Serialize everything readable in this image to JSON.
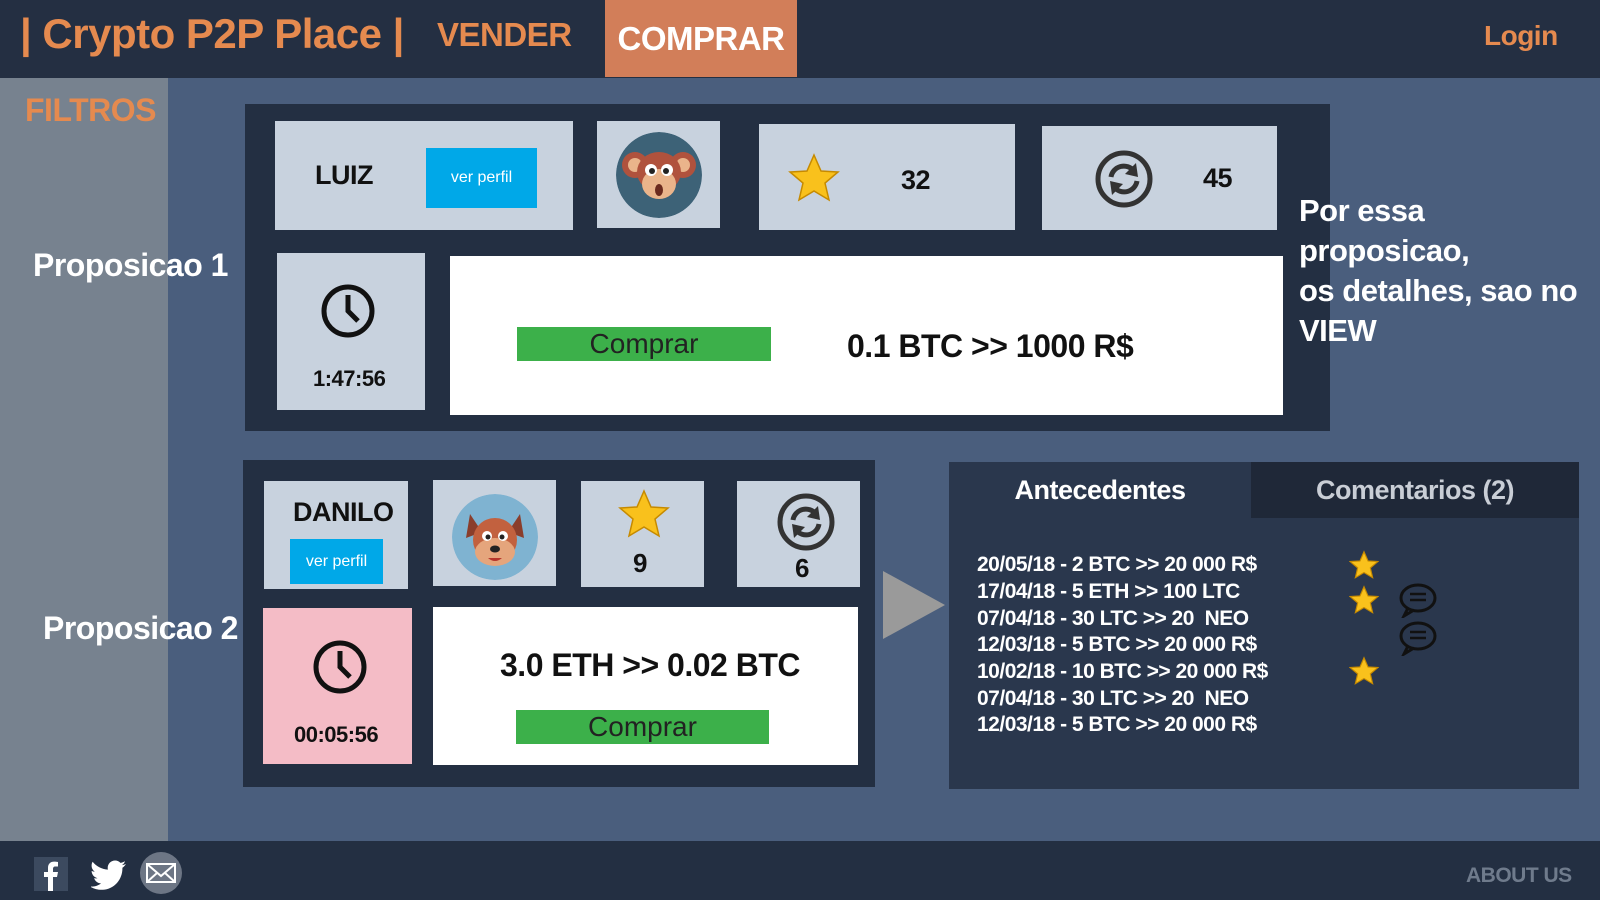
{
  "header": {
    "title": "| Crypto P2P Place |",
    "nav_sell": "VENDER",
    "nav_buy": "COMPRAR",
    "login": "Login",
    "accent": "#e58a4f",
    "active_tab_bg": "#d27e59"
  },
  "sidebar": {
    "filters": "FILTROS",
    "proposal1_label": "Proposicao 1",
    "proposal2_label": "Proposicao 2"
  },
  "proposal1": {
    "user": "LUIZ",
    "profile_button": "ver perfil",
    "avatar_icon": "monkey-avatar-icon",
    "rating": "32",
    "trades": "45",
    "timer": "1:47:56",
    "buy_button": "Comprar",
    "offer": "0.1 BTC >> 1000 R$",
    "note": "Por essa proposicao,\nos detalhes, sao no\nVIEW"
  },
  "proposal2": {
    "user": "DANILO",
    "profile_button": "ver perfil",
    "avatar_icon": "dog-avatar-icon",
    "rating": "9",
    "trades": "6",
    "timer": "00:05:56",
    "offer": "3.0 ETH >> 0.02 BTC",
    "buy_button": "Comprar"
  },
  "history": {
    "tab_history": "Antecedentes",
    "tab_comments": "Comentarios (2)",
    "rows": [
      "20/05/18 - 2 BTC >> 20 000 R$",
      "17/04/18 - 5 ETH >> 100 LTC",
      "07/04/18 - 30 LTC >> 20  NEO",
      "12/03/18 - 5 BTC >> 20 000 R$",
      "10/02/18 - 10 BTC >> 20 000 R$",
      "07/04/18 - 30 LTC >> 20  NEO",
      "12/03/18 - 5 BTC >> 20 000 R$"
    ]
  },
  "footer": {
    "about": "ABOUT US",
    "social_icons": [
      "facebook-icon",
      "twitter-icon",
      "mail-icon"
    ]
  }
}
